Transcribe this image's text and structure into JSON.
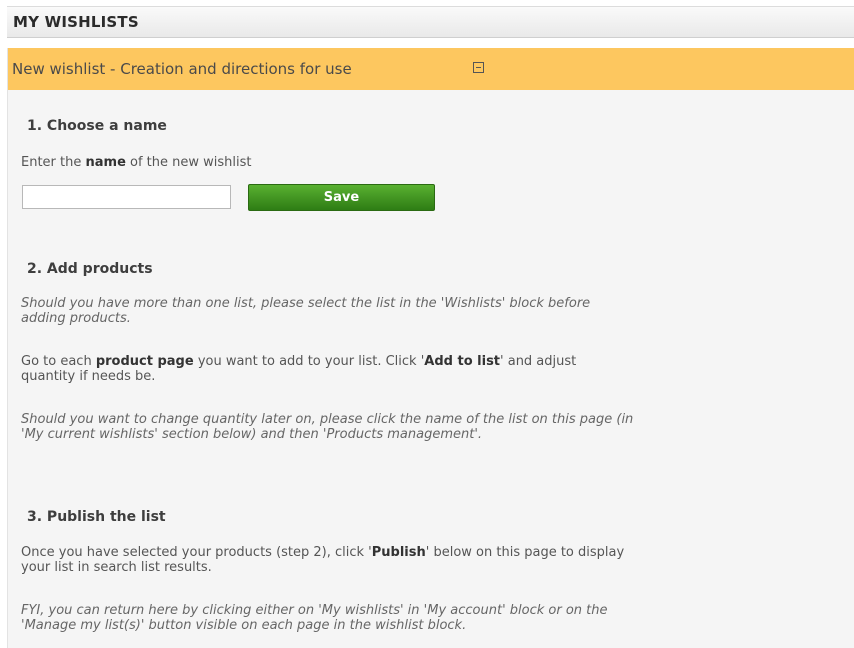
{
  "header": {
    "title": "MY WISHLISTS"
  },
  "panel": {
    "title": "New wishlist - Creation and directions for use"
  },
  "step1": {
    "heading": "1. Choose a name",
    "text_before": "Enter the ",
    "text_bold": "name",
    "text_after": " of the new wishlist",
    "input_value": "",
    "save_label": "Save"
  },
  "step2": {
    "heading": "2. Add products",
    "note1_line1": "Should you have more than one list, please select the list in the 'Wishlists' block before",
    "note1_line2": "adding products.",
    "p2_a": "Go to each ",
    "p2_b": "product page",
    "p2_c": " you want to add to your list. Click '",
    "p2_d": "Add to list",
    "p2_e": "' and adjust",
    "p2_line2": "quantity if needs be.",
    "note2_line1": "Should you want to change quantity later on, please click the name of the list on this page (in",
    "note2_line2": "'My current wishlists' section below) and then 'Products management'."
  },
  "step3": {
    "heading": "3. Publish the list",
    "p1_a": "Once you have selected your products (step 2), click '",
    "p1_b": "Publish",
    "p1_c": "' below on this page to display",
    "p1_line2": "your list in search list results.",
    "note_line1": "FYI, you can return here by clicking either on 'My wishlists' in 'My account' block or on the",
    "note_line2": "'Manage my list(s)' button visible on each page in the wishlist block."
  }
}
